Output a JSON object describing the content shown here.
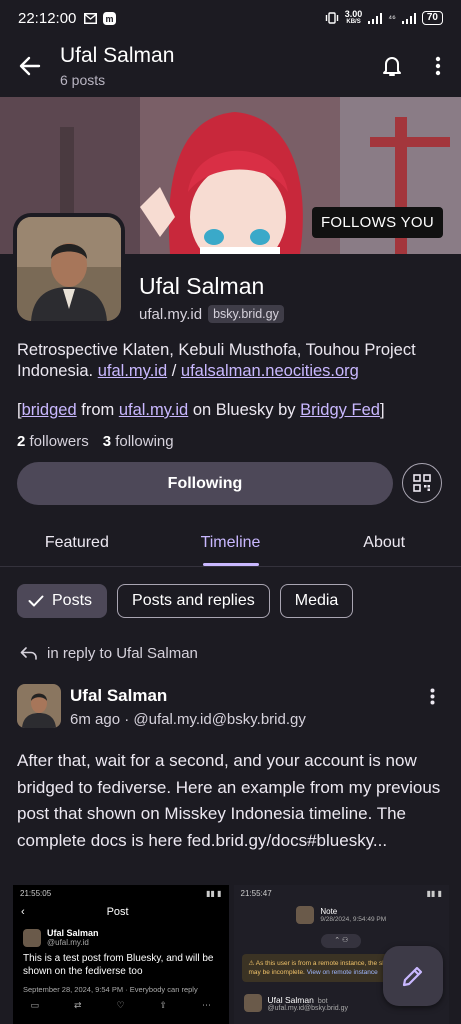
{
  "status_bar": {
    "time": "22:12:00",
    "speed_value": "3.00",
    "speed_unit": "KB/S",
    "network_label": "⁴⁶",
    "battery": "70"
  },
  "header": {
    "name": "Ufal Salman",
    "post_count": "6 posts"
  },
  "profile": {
    "follows_you": "FOLLOWS YOU",
    "display_name": "Ufal Salman",
    "handle": "ufal.my.id",
    "domain_badge": "bsky.brid.gy",
    "bio_text": "Retrospective Klaten, Kebuli Musthofa, Touhou Project Indonesia.",
    "bio_link1": "ufal.my.id",
    "bio_sep": "/",
    "bio_link2": "ufalsalman.neocities.org",
    "bridged_open": "[",
    "bridged_link": "bridged",
    "bridged_from": "from",
    "bridged_source": "ufal.my.id",
    "bridged_on": "on Bluesky by",
    "bridged_by": "Bridgy Fed",
    "bridged_close": "]",
    "followers_count": "2",
    "followers_label": "followers",
    "following_count": "3",
    "following_label": "following",
    "following_button": "Following"
  },
  "tabs": [
    {
      "label": "Featured"
    },
    {
      "label": "Timeline",
      "active": true
    },
    {
      "label": "About"
    }
  ],
  "filters": [
    {
      "label": "Posts",
      "selected": true
    },
    {
      "label": "Posts and replies"
    },
    {
      "label": "Media"
    }
  ],
  "post": {
    "reply_context": "in reply to Ufal Salman",
    "author": "Ufal Salman",
    "time": "6m ago",
    "sep": "·",
    "handle": "@ufal.my.id@bsky.brid.gy",
    "text": "After that, wait for a second, and your account is now bridged to fediverse. Here an example from my previous post that shown on Misskey Indonesia timeline. The complete docs is here fed.brid.gy/docs#bluesky..."
  },
  "media_left": {
    "time": "21:55:05",
    "title": "Post",
    "user": "Ufal Salman",
    "handle": "@ufal.my.id",
    "text": "This is a test post from Bluesky, and will be shown on the fediverse too",
    "date": "September 28, 2024, 9:54 PM",
    "visibility": "Everybody can reply"
  },
  "media_right": {
    "time": "21:55:47",
    "note_title": "Note",
    "note_date": "9/28/2024, 9:54:49 PM",
    "warning": "As this user is from a remote instance, the shown information may be incomplete.",
    "warning_link": "View on remote instance",
    "user": "Ufal Salman",
    "bot": "bot",
    "handle": "@ufal.my.id@bsky.brid.gy"
  },
  "colors": {
    "background": "#1c1b22",
    "accent": "#c9b8ff",
    "button": "#4d4858"
  }
}
